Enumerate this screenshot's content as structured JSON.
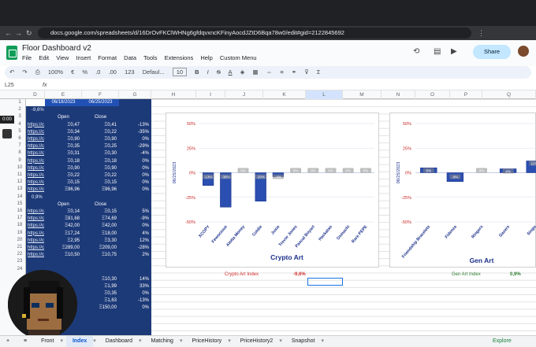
{
  "browser": {
    "url": "docs.google.com/spreadsheets/d/16DrOvFKClWHNg6gfdqvxncKFinyAocdJZtD6Bqa78w0/edit#gid=2122845692"
  },
  "app": {
    "title": "Floor Dashboard v2",
    "menu": [
      "File",
      "Edit",
      "View",
      "Insert",
      "Format",
      "Data",
      "Tools",
      "Extensions",
      "Help",
      "Custom Menu"
    ],
    "share": "Share"
  },
  "toolbar": {
    "zoom": "100%",
    "currency": "€",
    "percent": "%",
    "decimals_down": ".0",
    "decimals_up": ".00",
    "number_format": "123",
    "font": "Defaul...",
    "font_size": "10",
    "bold": "B",
    "italic": "I",
    "strike": "S",
    "text_color": "A"
  },
  "formula_bar": {
    "cell_ref": "L25",
    "fx": "fx"
  },
  "timer": "0:00",
  "columns": [
    "D",
    "E",
    "F",
    "G",
    "H",
    "I",
    "J",
    "K",
    "L",
    "M",
    "N",
    "O",
    "P",
    "Q"
  ],
  "rows": [
    "1",
    "2",
    "3",
    "4",
    "5",
    "6",
    "7",
    "8",
    "9",
    "10",
    "11",
    "12",
    "13",
    "14",
    "15",
    "16",
    "17",
    "18",
    "19",
    "20",
    "21",
    "22",
    "23",
    "24"
  ],
  "sheet": {
    "dates": [
      "06/18/2023",
      "06/25/2023"
    ],
    "block1": {
      "pct": "-9,6%",
      "open": "Open",
      "close": "Close",
      "rows": [
        {
          "link": "https://c",
          "open": "Ξ0,47",
          "close": "Ξ0,41",
          "chg": "-13%"
        },
        {
          "link": "https://c",
          "open": "Ξ0,34",
          "close": "Ξ0,22",
          "chg": "-35%"
        },
        {
          "link": "https://c",
          "open": "Ξ0,90",
          "close": "Ξ0,90",
          "chg": "0%"
        },
        {
          "link": "https://c",
          "open": "Ξ0,35",
          "close": "Ξ0,25",
          "chg": "-29%"
        },
        {
          "link": "https://c",
          "open": "Ξ0,31",
          "close": "Ξ0,30",
          "chg": "-4%"
        },
        {
          "link": "https://c",
          "open": "Ξ0,18",
          "close": "Ξ0,18",
          "chg": "0%"
        },
        {
          "link": "https://c",
          "open": "Ξ0,90",
          "close": "Ξ0,90",
          "chg": "0%"
        },
        {
          "link": "https://c",
          "open": "Ξ0,22",
          "close": "Ξ0,22",
          "chg": "0%"
        },
        {
          "link": "https://c",
          "open": "Ξ0,15",
          "close": "Ξ0,15",
          "chg": "0%"
        },
        {
          "link": "https://c",
          "open": "Ξ96,96",
          "close": "Ξ96,96",
          "chg": "0%"
        }
      ]
    },
    "block2": {
      "pct": "0,9%",
      "open": "Open",
      "close": "Close",
      "rows": [
        {
          "link": "https://c",
          "open": "Ξ0,14",
          "close": "Ξ0,15",
          "chg": "5%"
        },
        {
          "link": "https://c",
          "open": "Ξ81,68",
          "close": "Ξ74,69",
          "chg": "-9%"
        },
        {
          "link": "https://c",
          "open": "Ξ42,00",
          "close": "Ξ42,00",
          "chg": "0%"
        },
        {
          "link": "https://c",
          "open": "Ξ17,24",
          "close": "Ξ18,00",
          "chg": "4%"
        },
        {
          "link": "https://c",
          "open": "Ξ2,95",
          "close": "Ξ3,30",
          "chg": "12%"
        },
        {
          "link": "https://c",
          "open": "Ξ289,00",
          "close": "Ξ209,00",
          "chg": "-28%"
        },
        {
          "link": "https://c",
          "open": "Ξ10,50",
          "close": "Ξ10,75",
          "chg": "2%"
        }
      ]
    },
    "block3": {
      "rows": [
        {
          "open": "",
          "close": "Ξ10,30",
          "chg": "14%"
        },
        {
          "open": "",
          "close": "Ξ1,99",
          "chg": "33%"
        },
        {
          "open": "",
          "close": "Ξ0,35",
          "chg": "0%"
        },
        {
          "open": "",
          "close": "Ξ1,63",
          "chg": "-13%"
        },
        {
          "open": "",
          "close": "Ξ150,00",
          "chg": "0%"
        }
      ]
    },
    "crypto_index_label": "Crypto Art Index",
    "crypto_index_value": "-9,6%",
    "gen_index_label": "Gen Art Index",
    "gen_index_value": "0,9%"
  },
  "chart_data": [
    {
      "type": "bar",
      "title": "Crypto Art",
      "ylabel": "06/25/2023",
      "ylim": [
        -50,
        50
      ],
      "yticks": [
        "50%",
        "25%",
        "0%",
        "-25%",
        "-50%"
      ],
      "categories": [
        "XCOPY",
        "Fewocious",
        "Alotta Money",
        "Coldie",
        "Josie",
        "Trevor Jones",
        "Pascal Boyart",
        "Hackatao",
        "Osinachi",
        "Rare PEPE"
      ],
      "values": [
        -13,
        -35,
        0,
        -29,
        -4,
        0,
        0,
        0,
        0,
        0
      ],
      "labels": [
        "-13%",
        "-35%",
        "0%",
        "-29%",
        "-4%",
        "0%",
        "0%",
        "0%",
        "0%",
        "0%"
      ],
      "color": "#2a4fb0"
    },
    {
      "type": "bar",
      "title": "Gen Art",
      "ylabel": "06/25/2023",
      "ylim": [
        -50,
        50
      ],
      "yticks": [
        "50%",
        "25%",
        "0%",
        "-25%",
        "-50%"
      ],
      "categories": [
        "Friendship Bracelets",
        "Fidenza",
        "Ringers",
        "Gazers",
        "Singu"
      ],
      "values": [
        5,
        -9,
        0,
        4,
        12
      ],
      "labels": [
        "5%",
        "-9%",
        "0%",
        "4%",
        "12%"
      ],
      "color": "#2a4fb0"
    }
  ],
  "sheet_tabs": [
    "Front",
    "Index",
    "Dashboard",
    "Matching",
    "PriceHistory",
    "PriceHistory2",
    "Snapshot"
  ],
  "active_tab": "Index",
  "explore": "Explore"
}
